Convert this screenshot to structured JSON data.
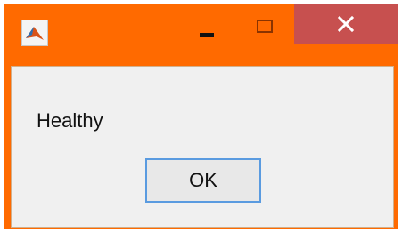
{
  "window": {
    "frame_color": "#ff6a00",
    "close_color": "#c7504f",
    "app_icon": "matlab-icon"
  },
  "titlebar": {
    "buttons": [
      "minimize-icon",
      "maximize-icon",
      "close-icon"
    ]
  },
  "dialog": {
    "message": "Healthy",
    "ok_label": "OK"
  }
}
